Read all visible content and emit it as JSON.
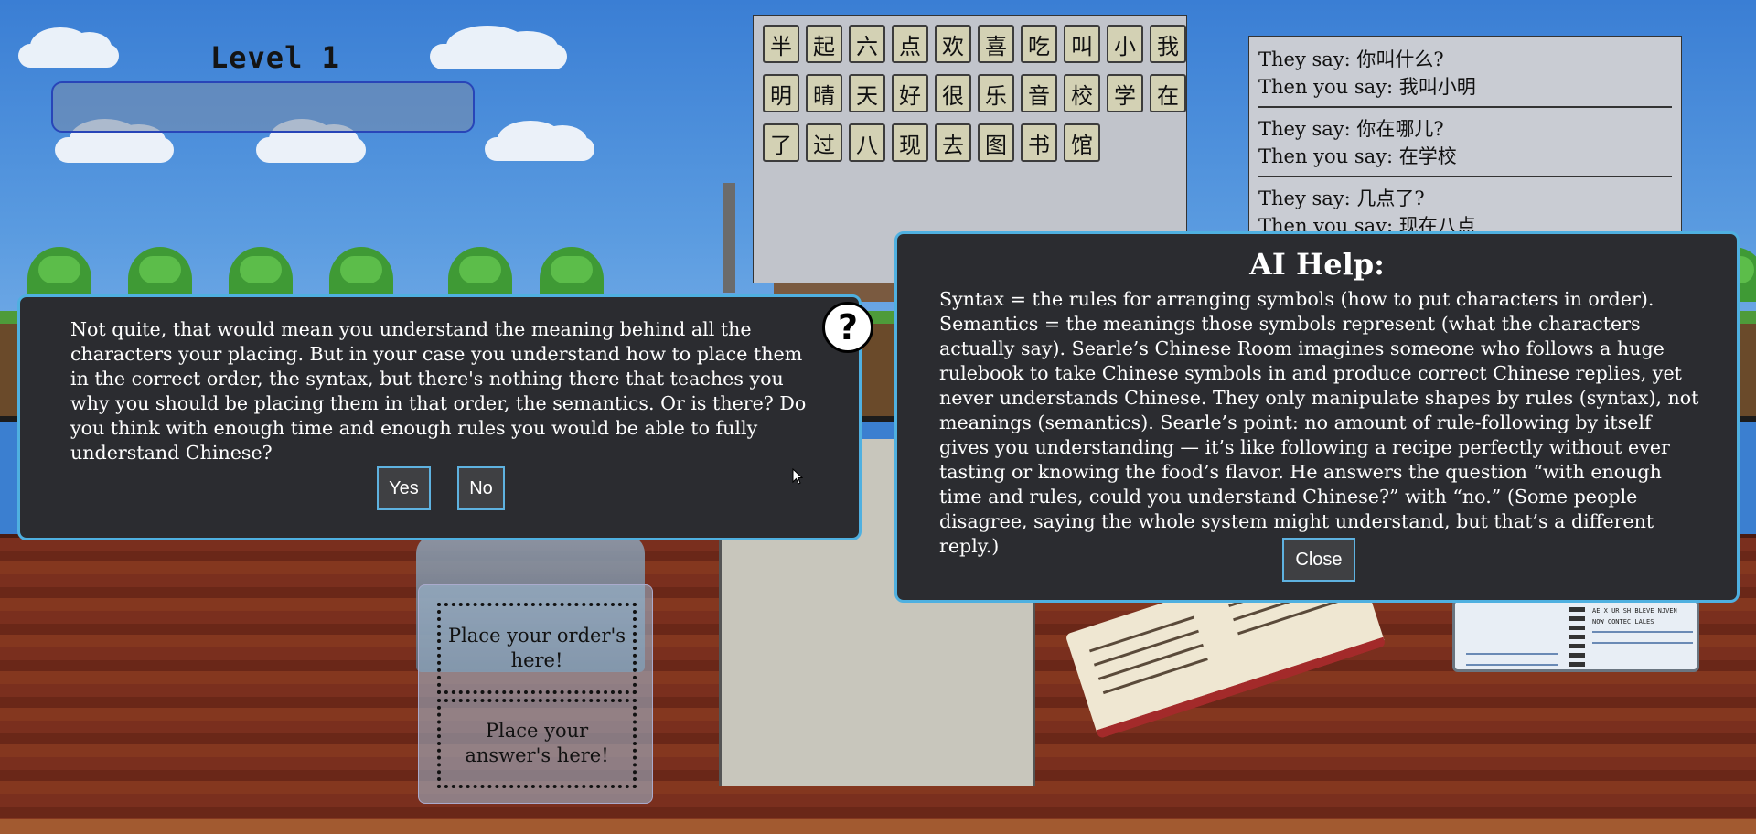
{
  "level": {
    "title": "Level 1",
    "progress": 0
  },
  "characters": [
    "半",
    "起",
    "六",
    "点",
    "欢",
    "喜",
    "吃",
    "叫",
    "小",
    "我",
    "明",
    "晴",
    "天",
    "好",
    "很",
    "乐",
    "音",
    "校",
    "学",
    "在",
    "了",
    "过",
    "八",
    "现",
    "去",
    "图",
    "书",
    "馆"
  ],
  "rulebook": [
    {
      "they_say": "They say: 你叫什么?",
      "you_say": "Then you say: 我叫小明"
    },
    {
      "they_say": "They say: 你在哪儿?",
      "you_say": "Then you say: 在学校"
    },
    {
      "they_say": "They say: 几点了?",
      "you_say": "Then you say: 现在八点"
    }
  ],
  "feedback_dialog": {
    "message": "Not quite, that would mean you understand the meaning behind all the characters your placing. But in your case you understand how to place them in the correct order, the syntax, but there's nothing there that teaches you why you should be placing them in that order, the semantics. Or is there? Do you think with enough time and enough rules you would be able to fully understand Chinese?",
    "help_label": "?",
    "yes_label": "Yes",
    "no_label": "No"
  },
  "ai_help": {
    "title": "AI Help:",
    "text": "Syntax = the rules for arranging symbols (how to put characters in order). Semantics = the meanings those symbols represent (what the characters actually say). Searle’s Chinese Room imagines someone who follows a huge rulebook to take Chinese symbols in and produce correct Chinese replies, yet never understands Chinese. They only manipulate shapes by rules (syntax), not meanings (semantics). Searle’s point: no amount of rule-following by itself gives you understanding — it’s like following a recipe perfectly without ever tasting or knowing the food’s flavor. He answers the question “with enough time and rules, could you understand Chinese?” with “no.” (Some people disagree, saying the whole system might understand, but that’s a different reply.)",
    "close_label": "Close"
  },
  "submit": {
    "order_label": "Place your order's here!",
    "answer_label": "Place your answer's here!"
  },
  "scenery": {
    "notebook_text": [
      "AE X UR SH BLEVE NJVEN",
      "NOW CONTEC LALES"
    ]
  },
  "colors": {
    "dialog_bg": "#2b2c30",
    "dialog_border": "#4fb0e0",
    "tile_bg": "#d3d1b4",
    "progress_border": "#2845b8"
  }
}
